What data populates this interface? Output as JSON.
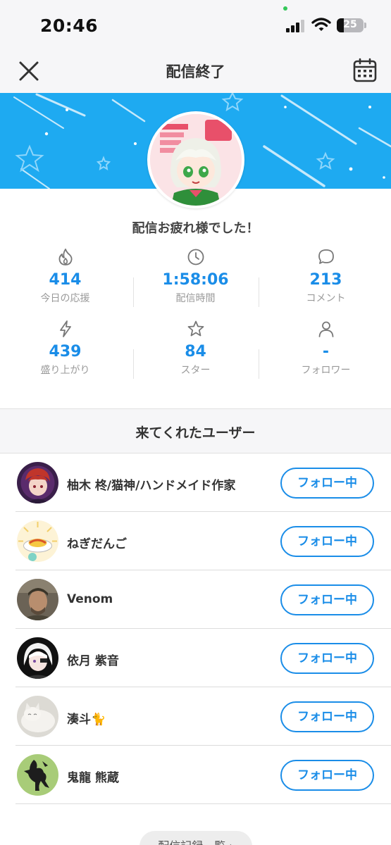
{
  "status_bar": {
    "time": "20:46",
    "battery": "25",
    "battery_level": 0.25
  },
  "nav": {
    "title": "配信終了"
  },
  "thanks_message": "配信お疲れ様でした！",
  "stats": [
    {
      "value": "414",
      "label": "今日の応援",
      "icon": "flame-icon"
    },
    {
      "value": "1:58:06",
      "label": "配信時間",
      "icon": "clock-icon"
    },
    {
      "value": "213",
      "label": "コメント",
      "icon": "comment-icon"
    },
    {
      "value": "439",
      "label": "盛り上がり",
      "icon": "lightning-icon"
    },
    {
      "value": "84",
      "label": "スター",
      "icon": "star-icon"
    },
    {
      "value": "-",
      "label": "フォロワー",
      "icon": "person-icon"
    }
  ],
  "section": {
    "title": "来てくれたユーザー"
  },
  "users": [
    {
      "name": "柚木 柊/猫神/ハンドメイド作家",
      "button": "フォロー中"
    },
    {
      "name": "ねぎだんご",
      "button": "フォロー中"
    },
    {
      "name": "Venom",
      "button": "フォロー中"
    },
    {
      "name": "依月 紫音",
      "button": "フォロー中"
    },
    {
      "name": "湊斗🐈",
      "button": "フォロー中"
    },
    {
      "name": "鬼龍 熊蔵",
      "button": "フォロー中"
    }
  ],
  "bottom": {
    "label": "配信記録一覧 ›"
  },
  "colors": {
    "accent": "#1a8de8",
    "banner": "#1eaaf1"
  }
}
